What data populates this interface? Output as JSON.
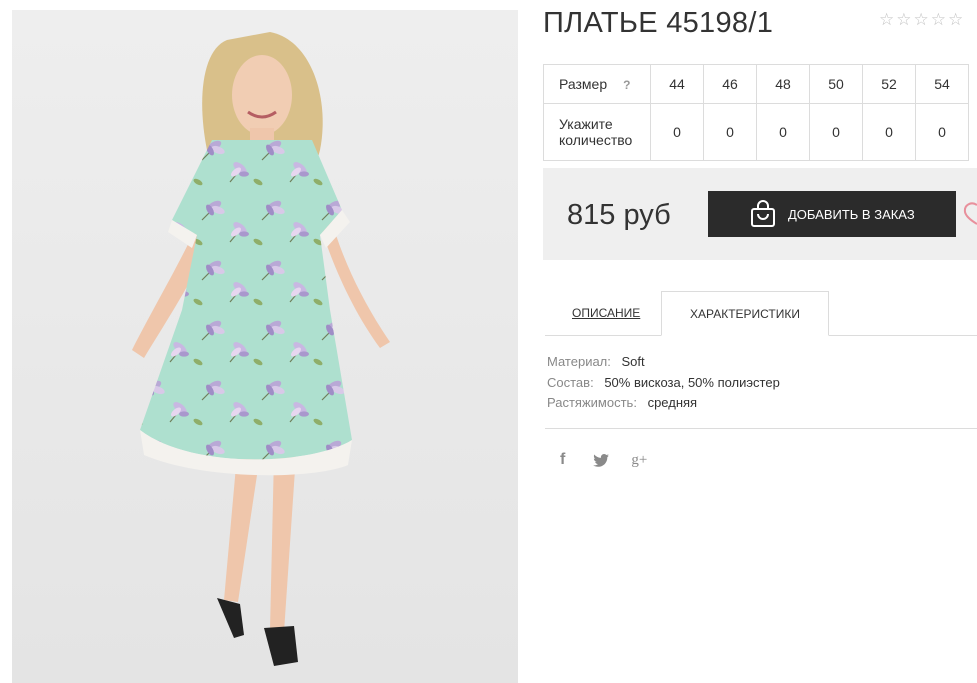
{
  "product": {
    "title": "ПЛАТЬЕ 45198/1",
    "image_alt": "product-photo",
    "rating": {
      "stars_total": 5,
      "stars_filled": 0
    }
  },
  "sizes": {
    "label": "Размер",
    "help": "?",
    "values": [
      "44",
      "46",
      "48",
      "50",
      "52",
      "54"
    ],
    "qty_label": "Укажите количество",
    "qty_values": [
      "0",
      "0",
      "0",
      "0",
      "0",
      "0"
    ]
  },
  "order": {
    "price": "815 руб",
    "button_label": "ДОБАВИТЬ В ЗАКАЗ",
    "button_icon": "shopping-bag-icon",
    "wishlist_icon": "heart-icon"
  },
  "tabs": [
    {
      "label": "ОПИСАНИЕ",
      "active": false
    },
    {
      "label": "ХАРАКТЕРИСТИКИ",
      "active": true
    }
  ],
  "characteristics": [
    {
      "key": "Материал:",
      "value": "Soft"
    },
    {
      "key": "Состав:",
      "value": "50% вискоза, 50% полиэстер"
    },
    {
      "key": "Растяжимость:",
      "value": "средняя"
    }
  ],
  "social": [
    {
      "name": "facebook-icon",
      "glyph": "f"
    },
    {
      "name": "twitter-icon",
      "glyph": ""
    },
    {
      "name": "google-plus-icon",
      "glyph": "g+"
    }
  ],
  "colors": {
    "button_bg": "#2b2b2b",
    "price_box_bg": "#efefef",
    "heart_accent": "#e8909c",
    "dress_base": "#aee0cf"
  }
}
